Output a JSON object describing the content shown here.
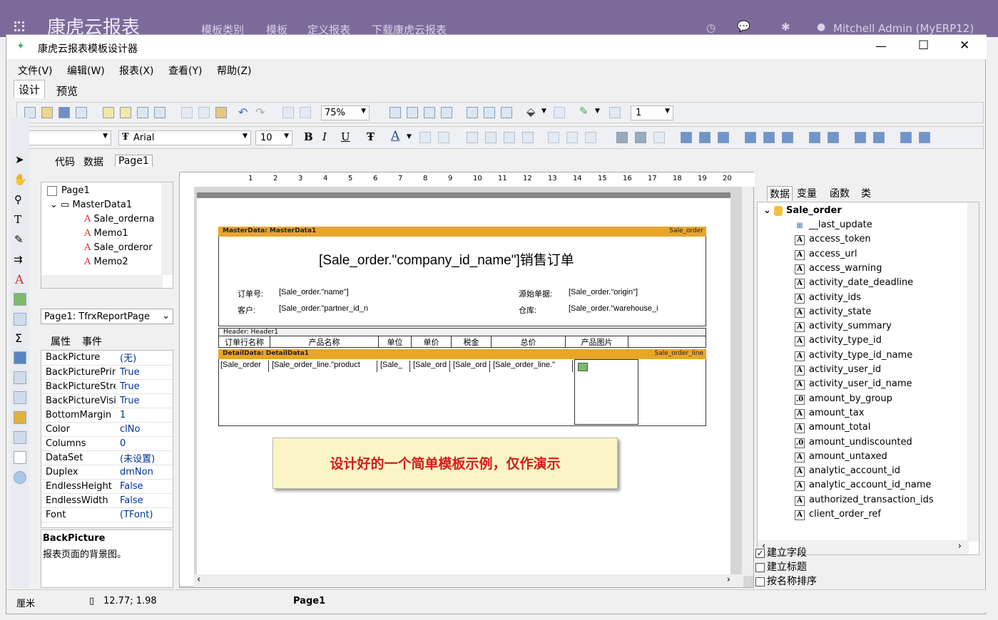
{
  "topbar": {
    "app": "康虎云报表",
    "nav": [
      "模板类别",
      "模板",
      "定义报表",
      "下载康虎云报表"
    ],
    "user": "Mitchell Admin (MyERP12)"
  },
  "window": {
    "title": "康虎云报表模板设计器",
    "min": "—",
    "max": "☐",
    "close": "✕"
  },
  "menu": [
    "文件(V)",
    "编辑(W)",
    "报表(X)",
    "查看(Y)",
    "帮助(Z)"
  ],
  "modetabs": [
    "设计",
    "预览"
  ],
  "toolbar": {
    "zoom": "75%",
    "font": "Arial",
    "size": "10",
    "linewidth": "1"
  },
  "pagetabs": [
    "代码",
    "数据",
    "Page1"
  ],
  "tree": {
    "root": "Page1",
    "items": [
      "MasterData1",
      "Sale_orderna",
      "Memo1",
      "Sale_orderor",
      "Memo2"
    ]
  },
  "objselect": "Page1: TfrxReportPage",
  "proptabs": [
    "属性",
    "事件"
  ],
  "props": [
    {
      "k": "BackPicture",
      "v": "(无)"
    },
    {
      "k": "BackPicturePrint",
      "v": "True"
    },
    {
      "k": "BackPictureStret",
      "v": "True"
    },
    {
      "k": "BackPictureVisibl",
      "v": "True"
    },
    {
      "k": "BottomMargin",
      "v": "1"
    },
    {
      "k": "Color",
      "v": "clNo"
    },
    {
      "k": "Columns",
      "v": "0"
    },
    {
      "k": "DataSet",
      "v": "(未设置)"
    },
    {
      "k": "Duplex",
      "v": "dmNon"
    },
    {
      "k": "EndlessHeight",
      "v": "False"
    },
    {
      "k": "EndlessWidth",
      "v": "False"
    },
    {
      "k": "Font",
      "v": "(TFont)"
    }
  ],
  "propdesc": {
    "title": "BackPicture",
    "text": "报表页面的背景图。"
  },
  "ruler": [
    "1",
    "2",
    "3",
    "4",
    "5",
    "6",
    "7",
    "8",
    "9",
    "10",
    "11",
    "12",
    "13",
    "14",
    "15",
    "16",
    "17",
    "18",
    "19",
    "20"
  ],
  "report": {
    "master_band": "MasterData: MasterData1",
    "master_src": "Sale_order",
    "title": "[Sale_order.\"company_id_name\"]销售订单",
    "lbl_order": "订单号:",
    "fld_order": "[Sale_order.\"name\"]",
    "lbl_cust": "客户:",
    "fld_cust": "[Sale_order.\"partner_id_n",
    "lbl_origin": "源始单据:",
    "fld_origin": "[Sale_order.\"origin\"]",
    "lbl_wh": "仓库:",
    "fld_wh": "[Sale_order.\"warehouse_i",
    "header_band": "Header: Header1",
    "cols": [
      "订单行名称",
      "产品名称",
      "单位",
      "单价",
      "税金",
      "总价",
      "产品图片"
    ],
    "detail_band": "DetailData: DetailData1",
    "detail_src": "Sale_order_line",
    "cells": [
      "[Sale_order",
      "[Sale_order_line.\"product",
      "[Sale_",
      "[Sale_ord",
      "[Sale_ord",
      "[Sale_order_line.\""
    ],
    "note": "设计好的一个简单模板示例，仅作演示"
  },
  "righttabs": [
    "数据",
    "变量",
    "函数",
    "类"
  ],
  "datatree": {
    "root": "Sale_order",
    "fields": [
      "__last_update",
      "access_token",
      "access_url",
      "access_warning",
      "activity_date_deadline",
      "activity_ids",
      "activity_state",
      "activity_summary",
      "activity_type_id",
      "activity_type_id_name",
      "activity_user_id",
      "activity_user_id_name",
      "amount_by_group",
      "amount_tax",
      "amount_total",
      "amount_undiscounted",
      "amount_untaxed",
      "analytic_account_id",
      "analytic_account_id_name",
      "authorized_transaction_ids",
      "client_order_ref"
    ]
  },
  "options": [
    {
      "label": "建立字段",
      "checked": true
    },
    {
      "label": "建立标题",
      "checked": false
    },
    {
      "label": "按名称排序",
      "checked": false
    }
  ],
  "status": {
    "unit": "厘米",
    "coords": "12.77; 1.98",
    "page": "Page1"
  }
}
